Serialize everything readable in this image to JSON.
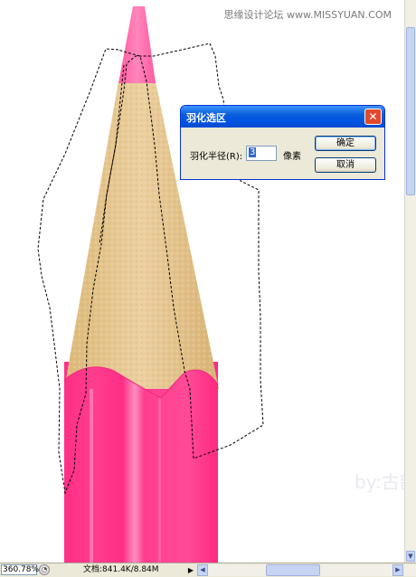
{
  "canvas": {
    "watermark_top": "思缘设计论坛 www.MISSYUAN.COM",
    "watermark_bottom": "by:古韵"
  },
  "dialog": {
    "title": "羽化选区",
    "close_icon": "close-icon",
    "feather_radius_label": "羽化半径(R):",
    "feather_radius_value": "3",
    "unit_label": "像素",
    "ok_label": "确定",
    "cancel_label": "取消"
  },
  "status_bar": {
    "zoom": "360.78%",
    "doc_info": "文档:841.4K/8.84M",
    "nav_icon": "navigator-icon",
    "menu_arrow": "▶"
  },
  "scrollbars": {
    "left_arrow": "◀",
    "right_arrow": "▶",
    "down_arrow": "▼"
  },
  "colors": {
    "pencil_pink": "#ff3d8f",
    "pencil_wood": "#e9c990",
    "dialog_title": "#0054e3",
    "dialog_bg": "#ece9d8"
  }
}
